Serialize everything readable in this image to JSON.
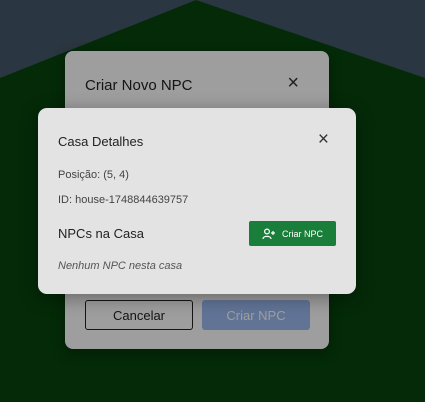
{
  "colors": {
    "scene_sky": "#8aaed2",
    "scene_grass": "#0f8a1a",
    "primary_green": "#1a7e3b",
    "primary_blue_disabled": "#9dbcf3"
  },
  "background_modal": {
    "title": "Criar Novo NPC",
    "close_icon": "close-icon",
    "cancel_label": "Cancelar",
    "create_label": "Criar NPC"
  },
  "house_modal": {
    "title": "Casa Detalhes",
    "close_icon": "close-icon",
    "position": "Posição: (5, 4)",
    "id": "ID: house-1748844639757",
    "npcs_heading": "NPCs na Casa",
    "create_npc_label": "Criar NPC",
    "create_npc_icon": "user-plus-icon",
    "empty_text": "Nenhum NPC nesta casa"
  }
}
